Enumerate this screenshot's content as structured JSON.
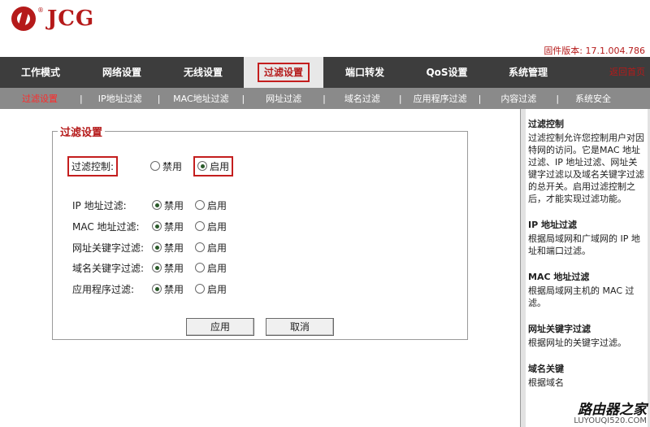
{
  "brand": {
    "reg": "®",
    "name": "JCG"
  },
  "firmware": "固件版本: 17.1.004.786",
  "nav": {
    "items": [
      {
        "label": "工作模式"
      },
      {
        "label": "网络设置"
      },
      {
        "label": "无线设置"
      },
      {
        "label": "过滤设置",
        "active": true
      },
      {
        "label": "端口转发"
      },
      {
        "label": "QoS设置"
      },
      {
        "label": "系统管理"
      }
    ],
    "home": "返回首页"
  },
  "subnav": {
    "items": [
      {
        "label": "过滤设置",
        "active": true
      },
      {
        "label": "IP地址过滤"
      },
      {
        "label": "MAC地址过滤"
      },
      {
        "label": "网址过滤"
      },
      {
        "label": "域名过滤"
      },
      {
        "label": "应用程序过滤"
      },
      {
        "label": "内容过滤"
      },
      {
        "label": "系统安全"
      }
    ],
    "separator": "|"
  },
  "panel": {
    "title": "过滤设置",
    "control": {
      "label": "过滤控制:",
      "disable": "禁用",
      "enable": "启用",
      "selected": "enable"
    },
    "rows": [
      {
        "label": "IP 地址过滤:",
        "disable": "禁用",
        "enable": "启用",
        "selected": "disable"
      },
      {
        "label": "MAC 地址过滤:",
        "disable": "禁用",
        "enable": "启用",
        "selected": "disable"
      },
      {
        "label": "网址关键字过滤:",
        "disable": "禁用",
        "enable": "启用",
        "selected": "disable"
      },
      {
        "label": "域名关键字过滤:",
        "disable": "禁用",
        "enable": "启用",
        "selected": "disable"
      },
      {
        "label": "应用程序过滤:",
        "disable": "禁用",
        "enable": "启用",
        "selected": "disable"
      }
    ],
    "apply": "应用",
    "cancel": "取消"
  },
  "help": {
    "sections": [
      {
        "title": "过滤控制",
        "text": "过滤控制允许您控制用户对因特网的访问。它是MAC 地址过滤、IP 地址过滤、网址关键字过滤以及域名关键字过滤的总开关。启用过滤控制之后，才能实现过滤功能。"
      },
      {
        "title": "IP 地址过滤",
        "text": "根据局域网和广域网的 IP 地址和端口过滤。"
      },
      {
        "title": "MAC 地址过滤",
        "text": "根据局域网主机的 MAC 过滤。"
      },
      {
        "title": "网址关键字过滤",
        "text": "根据网址的关键字过滤。"
      },
      {
        "title": "域名关键",
        "text": "根据域名"
      }
    ]
  },
  "watermark": {
    "title": "路由器之家",
    "url": "LUYOUQI520.COM"
  },
  "colors": {
    "brand_red": "#b51a1a",
    "nav_bg": "#3d3d3d",
    "subnav_bg": "#8a8a8a",
    "highlight_border": "#c41e1e"
  }
}
